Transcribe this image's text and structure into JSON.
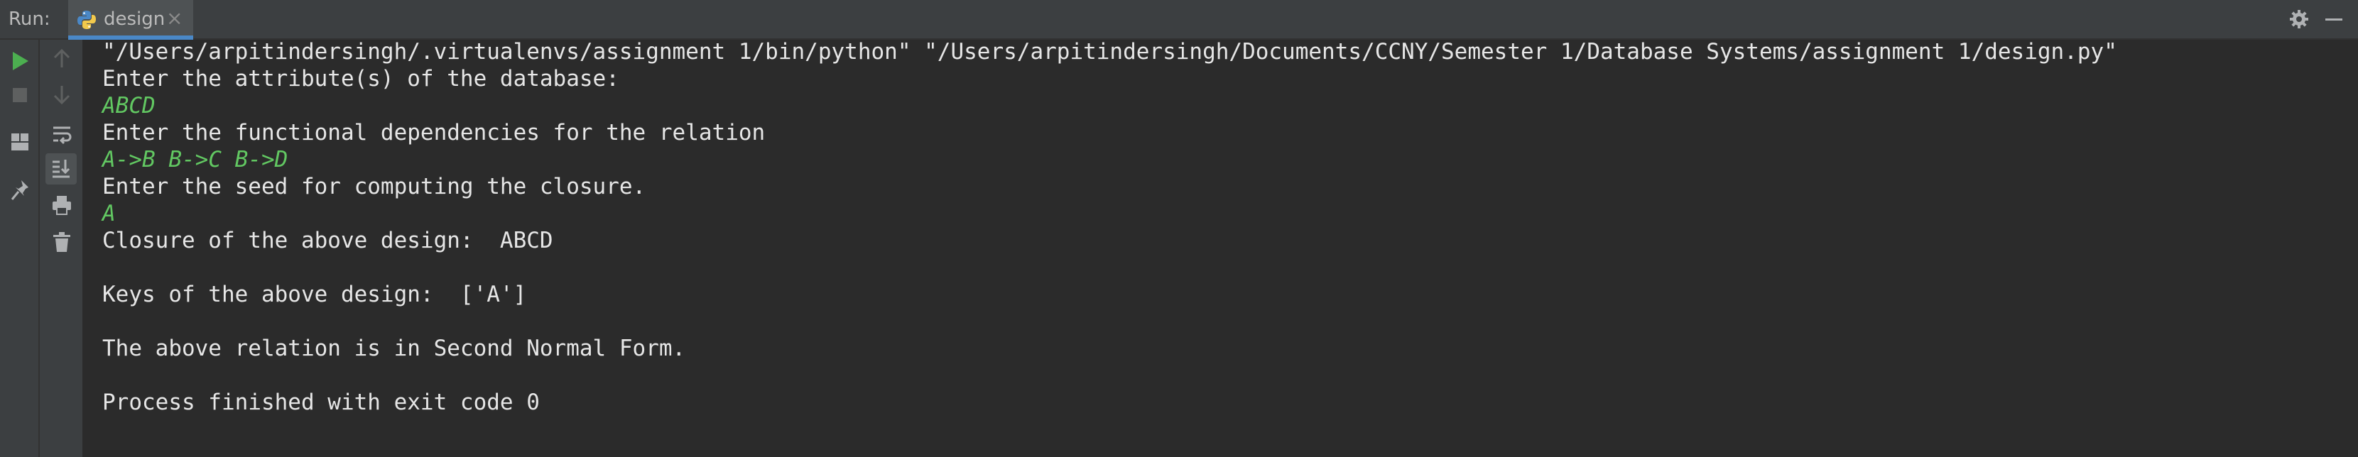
{
  "toolwindow": {
    "run_label": "Run:",
    "tab_label": "design",
    "tab_close": "×"
  },
  "colors": {
    "background": "#2b2b2b",
    "toolbar": "#3c3f41",
    "console_text": "#e6e6e6",
    "user_input": "#62c862",
    "run_green": "#4caf50",
    "tab_underline": "#4a88c7"
  },
  "left_toolbar": {
    "icons": [
      "run-icon",
      "stop-icon",
      "layout-icon",
      "pin-icon",
      "up-arrow-icon",
      "down-arrow-icon",
      "soft-wrap-icon",
      "scroll-to-end-icon",
      "print-icon",
      "trash-icon"
    ]
  },
  "console": {
    "command": "\"/Users/arpitindersingh/.virtualenvs/assignment 1/bin/python\" \"/Users/arpitindersingh/Documents/CCNY/Semester 1/Database Systems/assignment 1/design.py\"",
    "prompt_attributes": "Enter the attribute(s) of the database:",
    "input_attributes": "ABCD",
    "prompt_fds": "Enter the functional dependencies for the relation",
    "input_fds": "A->B B->C B->D",
    "prompt_seed": "Enter the seed for computing the closure.",
    "input_seed": "A",
    "closure": "Closure of the above design:  ABCD",
    "keys": "Keys of the above design:  ['A']",
    "normal_form": "The above relation is in Second Normal Form.",
    "exit": "Process finished with exit code 0"
  }
}
